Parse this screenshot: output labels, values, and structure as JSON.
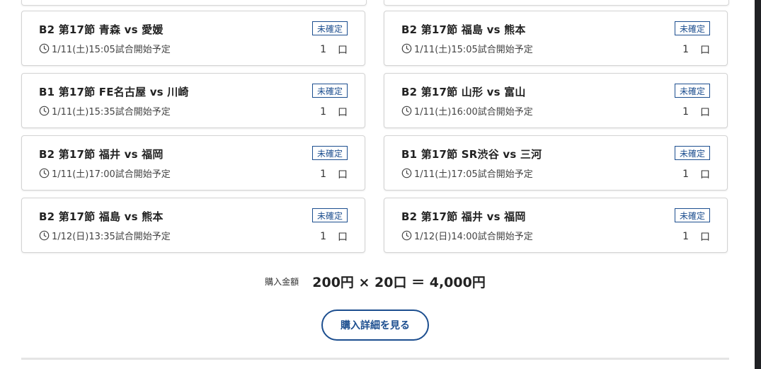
{
  "badge_text": "未確定",
  "matches": [
    {
      "title": "B2 第17節 青森 vs 愛媛",
      "time": "1/11(土)15:05試合開始予定",
      "count": "1",
      "unit": "口"
    },
    {
      "title": "B2 第17節 福島 vs 熊本",
      "time": "1/11(土)15:05試合開始予定",
      "count": "1",
      "unit": "口"
    },
    {
      "title": "B1 第17節 FE名古屋 vs 川崎",
      "time": "1/11(土)15:35試合開始予定",
      "count": "1",
      "unit": "口"
    },
    {
      "title": "B2 第17節 山形 vs 富山",
      "time": "1/11(土)16:00試合開始予定",
      "count": "1",
      "unit": "口"
    },
    {
      "title": "B2 第17節 福井 vs 福岡",
      "time": "1/11(土)17:00試合開始予定",
      "count": "1",
      "unit": "口"
    },
    {
      "title": "B1 第17節 SR渋谷 vs 三河",
      "time": "1/11(土)17:05試合開始予定",
      "count": "1",
      "unit": "口"
    },
    {
      "title": "B2 第17節 福島 vs 熊本",
      "time": "1/12(日)13:35試合開始予定",
      "count": "1",
      "unit": "口"
    },
    {
      "title": "B2 第17節 福井 vs 福岡",
      "time": "1/12(日)14:00試合開始予定",
      "count": "1",
      "unit": "口"
    }
  ],
  "summary": {
    "label": "購入金額",
    "expression": "200円 × 20口 ＝ 4,000円"
  },
  "detail_button": "購入詳細を見る",
  "colors": {
    "accent": "#1c4e8f",
    "card_border": "#d3d3d3"
  }
}
